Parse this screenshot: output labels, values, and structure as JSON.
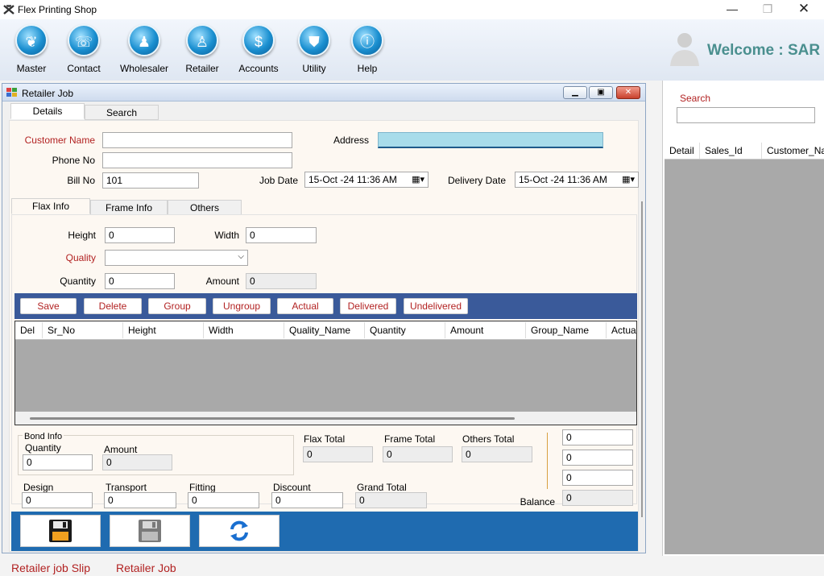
{
  "app": {
    "title": "Flex Printing Shop"
  },
  "ribbon": {
    "items": [
      {
        "label": "Master",
        "glyph": "❦"
      },
      {
        "label": "Contact",
        "glyph": "☏"
      },
      {
        "label": "Wholesaler",
        "glyph": "♟"
      },
      {
        "label": "Retailer",
        "glyph": "♙"
      },
      {
        "label": "Accounts",
        "glyph": "$"
      },
      {
        "label": "Utility",
        "glyph": "⛊"
      },
      {
        "label": "Help",
        "glyph": "ⓘ"
      }
    ],
    "welcome": "Welcome : SAR"
  },
  "side": {
    "search_label": "Search",
    "search_value": "",
    "columns": [
      "Detail",
      "Sales_Id",
      "Customer_Nar"
    ]
  },
  "job": {
    "title": "Retailer Job",
    "tabs": [
      "Details",
      "Search"
    ],
    "form": {
      "customer_name_label": "Customer Name",
      "customer_name": "",
      "address_label": "Address",
      "address": "",
      "phone_label": "Phone No",
      "phone": "",
      "bill_label": "Bill No",
      "bill": "101",
      "job_date_label": "Job Date",
      "job_date": "15-Oct -24 11:36 AM",
      "delivery_label": "Delivery Date",
      "delivery_date": "15-Oct -24 11:36 AM"
    },
    "subtabs": [
      "Flax Info",
      "Frame Info",
      "Others"
    ],
    "flax": {
      "height_label": "Height",
      "height": "0",
      "width_label": "Width",
      "width": "0",
      "quality_label": "Quality",
      "quality": "",
      "quantity_label": "Quantity",
      "quantity": "0",
      "amount_label": "Amount",
      "amount": "0"
    },
    "actions": [
      "Save",
      "Delete",
      "Group",
      "Ungroup",
      "Actual",
      "Delivered",
      "Undelivered"
    ],
    "grid_columns": [
      "Del",
      "Sr_No",
      "Height",
      "Width",
      "Quality_Name",
      "Quantity",
      "Amount",
      "Group_Name",
      "Actua"
    ],
    "bond": {
      "title": "Bond Info",
      "quantity_label": "Quantity",
      "quantity": "0",
      "amount_label": "Amount",
      "amount": "0"
    },
    "totals": {
      "flax_label": "Flax Total",
      "flax": "0",
      "frame_label": "Frame Total",
      "frame": "0",
      "others_label": "Others Total",
      "others": "0",
      "design_label": "Design",
      "design": "0",
      "transport_label": "Transport",
      "transport": "0",
      "fitting_label": "Fitting",
      "fitting": "0",
      "discount_label": "Discount",
      "discount": "0",
      "grand_label": "Grand Total",
      "grand": "0",
      "r1": "0",
      "r2": "0",
      "r3": "0",
      "balance_label": "Balance",
      "balance": "0"
    }
  },
  "footer": {
    "links": [
      "Retailer job Slip",
      "Retailer Job"
    ]
  },
  "colors": {
    "accent": "#b22222",
    "bar": "#3a5a9a",
    "blue_bar": "#1f6bb0"
  }
}
